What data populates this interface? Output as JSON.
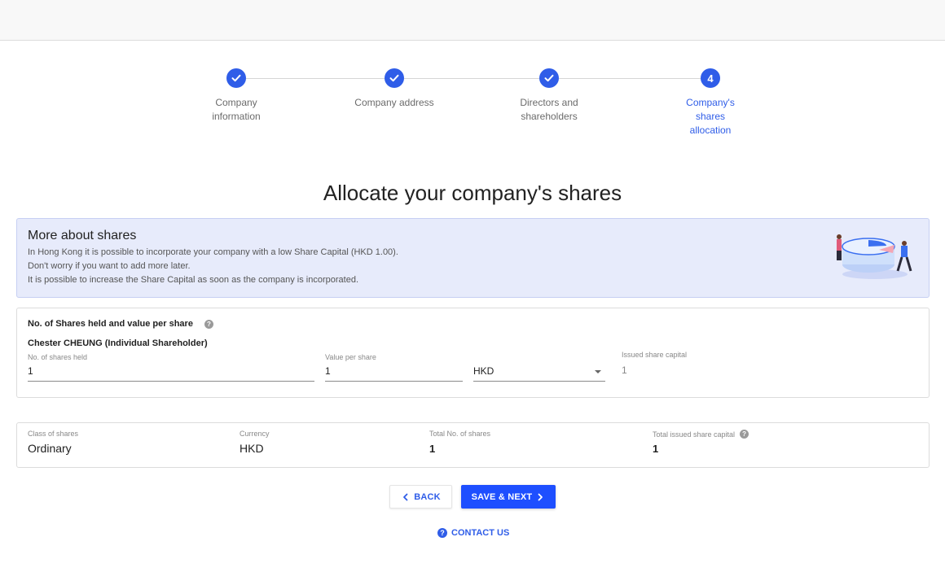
{
  "stepper": {
    "steps": [
      {
        "label_line1": "Company",
        "label_line2": "information",
        "label_line3": "",
        "status": "done"
      },
      {
        "label_line1": "Company address",
        "label_line2": "",
        "label_line3": "",
        "status": "done"
      },
      {
        "label_line1": "Directors and",
        "label_line2": "shareholders",
        "label_line3": "",
        "status": "done"
      },
      {
        "label_line1": "Company's",
        "label_line2": "shares",
        "label_line3": "allocation",
        "status": "active",
        "number": "4"
      }
    ]
  },
  "page": {
    "title": "Allocate your company's shares"
  },
  "banner": {
    "title": "More about shares",
    "line1": "In Hong Kong it is possible to incorporate your company with a low Share Capital (HKD 1.00).",
    "line2": "Don't worry if you want to add more later.",
    "line3": "It is possible to increase the Share Capital as soon as the company is incorporated."
  },
  "shares_form": {
    "section_title": "No. of Shares held and value per share",
    "help_icon": "question-circle-icon",
    "holder_name": "Chester CHEUNG (Individual Shareholder)",
    "shares_held_label": "No. of shares held",
    "shares_held_value": "1",
    "value_per_share_label": "Value per share",
    "value_per_share_value": "1",
    "currency_value": "HKD",
    "issued_capital_label": "Issued share capital",
    "issued_capital_value": "1"
  },
  "summary": {
    "class_label": "Class of shares",
    "class_value": "Ordinary",
    "currency_label": "Currency",
    "currency_value": "HKD",
    "total_shares_label": "Total No. of shares",
    "total_shares_value": "1",
    "total_capital_label": "Total issued share capital",
    "total_capital_value": "1"
  },
  "actions": {
    "back_label": "BACK",
    "next_label": "SAVE & NEXT",
    "contact_label": "CONTACT US"
  },
  "colors": {
    "accent": "#2f5de8",
    "primary_button": "#1e4fff",
    "banner_bg": "#e7ebfb"
  }
}
